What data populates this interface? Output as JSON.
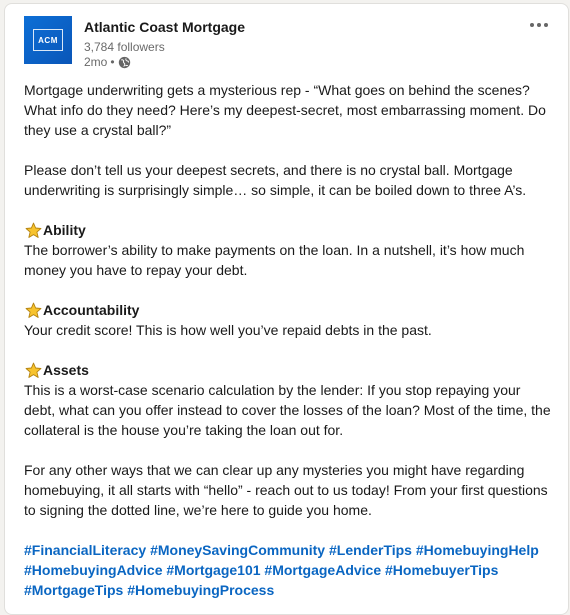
{
  "post": {
    "author": {
      "name": "Atlantic Coast Mortgage",
      "followers": "3,784 followers",
      "time": "2mo",
      "separator": "•",
      "logo_text": "ACM",
      "visibility_icon": "globe-icon"
    },
    "menu_icon": "more-options-icon",
    "intro": "Mortgage underwriting gets a mysterious rep - “What goes on behind the scenes? What info do they need? Here’s my deepest-secret, most embarrassing moment. Do they use a crystal ball?”",
    "intro2": "Please don’t tell us your deepest secrets, and there is no crystal ball. Mortgage underwriting is surprisingly simple… so simple, it can be boiled down to three A’s.",
    "sections": [
      {
        "icon": "star-icon",
        "title": "Ability",
        "text": "The borrower’s ability to make payments on the loan. In a nutshell, it’s how much money you have to repay your debt."
      },
      {
        "icon": "star-icon",
        "title": "Accountability",
        "text": "Your credit score! This is how well you’ve repaid debts in the past."
      },
      {
        "icon": "star-icon",
        "title": "Assets",
        "text": "This is a worst-case scenario calculation by the lender: If you stop repaying your debt, what can you offer instead to cover the losses of the loan? Most of the time, the collateral is the house you’re taking the loan out for."
      }
    ],
    "closing": "For any other ways that we can clear up any mysteries you might have regarding homebuying, it all starts with “hello” - reach out to us today! From your first questions to signing the dotted line, we’re here to guide you home.",
    "hashtags": [
      "#FinancialLiteracy",
      "#MoneySavingCommunity",
      "#LenderTips",
      "#HomebuyingHelp",
      "#HomebuyingAdvice",
      "#Mortgage101",
      "#MortgageAdvice",
      "#HomebuyerTips",
      "#MortgageTips",
      "#HomebuyingProcess"
    ],
    "colors": {
      "link": "#0a66c2",
      "logo_bg": "#0a66c2",
      "star": "#f5c518"
    }
  }
}
